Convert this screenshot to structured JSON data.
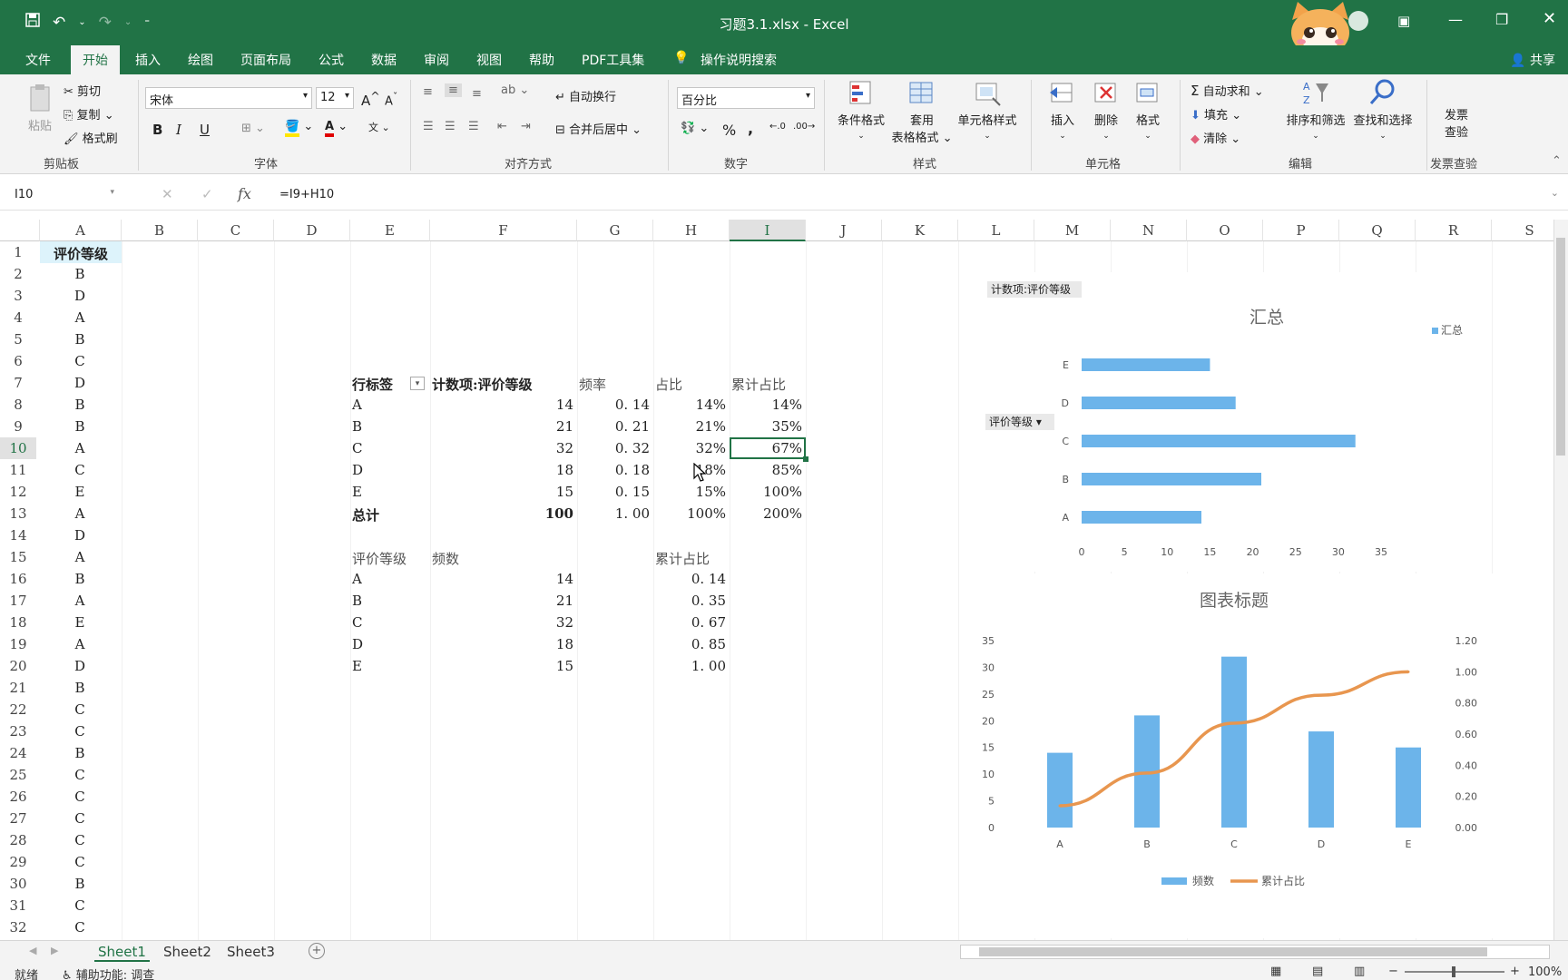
{
  "window": {
    "title": "习题3.1.xlsx  -  Excel",
    "share": "共享"
  },
  "tabs": [
    "文件",
    "开始",
    "插入",
    "绘图",
    "页面布局",
    "公式",
    "数据",
    "审阅",
    "视图",
    "帮助",
    "PDF工具集",
    "操作说明搜索"
  ],
  "active_tab": "开始",
  "ribbon": {
    "clipboard": {
      "paste": "粘贴",
      "cut": "剪切",
      "copy": "复制",
      "painter": "格式刷",
      "label": "剪贴板"
    },
    "font": {
      "name": "宋体",
      "size": "12",
      "label": "字体",
      "bold": "B",
      "italic": "I",
      "underline": "U"
    },
    "align": {
      "wrap": "自动换行",
      "merge": "合并后居中",
      "label": "对齐方式"
    },
    "number": {
      "format": "百分比",
      "percent": "%",
      "comma": ",",
      "label": "数字"
    },
    "styles": {
      "conditional": "条件格式",
      "table1": "套用",
      "table2": "表格格式",
      "cell": "单元格样式",
      "label": "样式"
    },
    "cells": {
      "insert": "插入",
      "delete": "删除",
      "format": "格式",
      "label": "单元格"
    },
    "editing": {
      "autosum": "自动求和",
      "fill": "填充",
      "clear": "清除",
      "sort": "排序和筛选",
      "find": "查找和选择",
      "label": "编辑"
    },
    "invoice": {
      "btn1": "发票",
      "btn2": "查验",
      "label": "发票查验"
    }
  },
  "formula_bar": {
    "name_box": "I10",
    "fx": "fx",
    "formula": "=I9+H10"
  },
  "columns": [
    "A",
    "B",
    "C",
    "D",
    "E",
    "F",
    "G",
    "H",
    "I",
    "J",
    "K",
    "L",
    "M",
    "N",
    "O",
    "P",
    "Q",
    "R",
    "S"
  ],
  "selected_column": "I",
  "rows": [
    "1",
    "2",
    "3",
    "4",
    "5",
    "6",
    "7",
    "8",
    "9",
    "10",
    "11",
    "12",
    "13",
    "14",
    "15",
    "16",
    "17",
    "18",
    "19",
    "20",
    "21",
    "22",
    "23",
    "24",
    "25",
    "26",
    "27",
    "28",
    "29",
    "30",
    "31",
    "32"
  ],
  "selected_row": "10",
  "column_a": {
    "header": "评价等级",
    "values": [
      "B",
      "D",
      "A",
      "B",
      "C",
      "D",
      "B",
      "B",
      "A",
      "C",
      "E",
      "A",
      "D",
      "A",
      "B",
      "A",
      "E",
      "A",
      "D",
      "B",
      "C",
      "C",
      "B",
      "C",
      "C",
      "C",
      "C",
      "C",
      "B",
      "C",
      "C"
    ]
  },
  "pivot": {
    "headers": [
      "行标签",
      "计数项:评价等级",
      "频率",
      "占比",
      "累计占比"
    ],
    "rows": [
      [
        "A",
        "14",
        "0. 14",
        "14%",
        "14%"
      ],
      [
        "B",
        "21",
        "0. 21",
        "21%",
        "35%"
      ],
      [
        "C",
        "32",
        "0. 32",
        "32%",
        "67%"
      ],
      [
        "D",
        "18",
        "0. 18",
        "18%",
        "85%"
      ],
      [
        "E",
        "15",
        "0. 15",
        "15%",
        "100%"
      ]
    ],
    "total": [
      "总计",
      "100",
      "1. 00",
      "100%",
      "200%"
    ]
  },
  "freq_table": {
    "headers": [
      "评价等级",
      "频数",
      "累计占比"
    ],
    "rows": [
      [
        "A",
        "14",
        "0. 14"
      ],
      [
        "B",
        "21",
        "0. 35"
      ],
      [
        "C",
        "32",
        "0. 67"
      ],
      [
        "D",
        "18",
        "0. 85"
      ],
      [
        "E",
        "15",
        "1. 00"
      ]
    ]
  },
  "chart_data": [
    {
      "type": "bar",
      "orientation": "horizontal",
      "title": "汇总",
      "field_button": "计数项:评价等级",
      "axis_button": "评价等级",
      "categories": [
        "A",
        "B",
        "C",
        "D",
        "E"
      ],
      "series": [
        {
          "name": "汇总",
          "values": [
            14,
            21,
            32,
            18,
            15
          ]
        }
      ],
      "xlim": [
        0,
        35
      ],
      "xticks": [
        "0",
        "5",
        "10",
        "15",
        "20",
        "25",
        "30",
        "35"
      ],
      "legend": "right",
      "color": "#6cb4ea"
    },
    {
      "type": "bar",
      "title": "图表标题",
      "categories": [
        "A",
        "B",
        "C",
        "D",
        "E"
      ],
      "series": [
        {
          "name": "频数",
          "type": "bar",
          "axis": "left",
          "values": [
            14,
            21,
            32,
            18,
            15
          ]
        },
        {
          "name": "累计占比",
          "type": "line",
          "axis": "right",
          "values": [
            0.14,
            0.35,
            0.67,
            0.85,
            1.0
          ]
        }
      ],
      "ylim": [
        0,
        35
      ],
      "yticks": [
        "0",
        "5",
        "10",
        "15",
        "20",
        "25",
        "30",
        "35"
      ],
      "y2lim": [
        0,
        1.2
      ],
      "y2ticks": [
        "0.00",
        "0.20",
        "0.40",
        "0.60",
        "0.80",
        "1.00",
        "1.20"
      ],
      "legend": "bottom",
      "colors": [
        "#6cb4ea",
        "#e8964f"
      ]
    }
  ],
  "sheets": [
    "Sheet1",
    "Sheet2",
    "Sheet3"
  ],
  "active_sheet": "Sheet1",
  "status": {
    "ready": "就绪",
    "accessibility": "辅助功能: 调查",
    "zoom": "100%"
  }
}
